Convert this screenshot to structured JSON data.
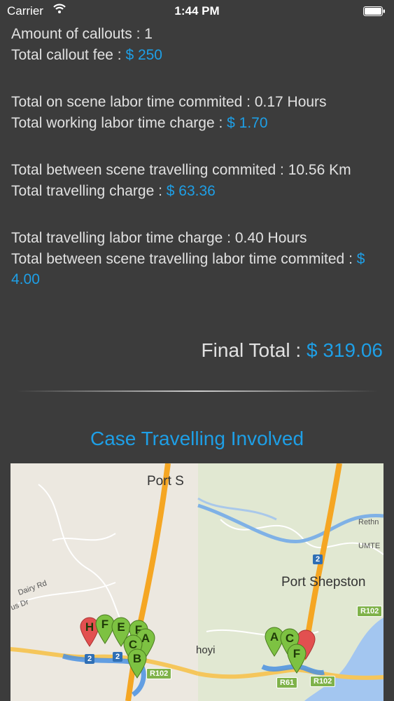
{
  "status_bar": {
    "carrier": "Carrier",
    "time": "1:44 PM"
  },
  "summary": {
    "callouts_amount": "Amount of callouts : 1",
    "callout_fee_label": "Total callout fee : ",
    "callout_fee_value": "$ 250",
    "on_scene_labor": "Total on scene labor time commited : 0.17 Hours",
    "working_labor_charge_label": "Total working labor time charge : ",
    "working_labor_charge_value": "$ 1.70",
    "between_scene_travel": "Total between scene travelling commited : 10.56 Km",
    "travelling_charge_label": "Total travelling charge : ",
    "travelling_charge_value": "$ 63.36",
    "travel_labor_time_charge": "Total travelling labor time charge : 0.40 Hours",
    "between_scene_labor_label": "Total between scene travelling labor time commited : ",
    "between_scene_labor_value": "$ 4.00",
    "final_total_label": "Final Total : ",
    "final_total_value": "$ 319.06"
  },
  "section_title": "Case Travelling Involved",
  "map": {
    "labels": {
      "port_s": "Port S",
      "port_shepstone": "Port Shepston",
      "dairy_rd": "Dairy Rd",
      "us_dr": "us Dr",
      "hoyi": "hoyi",
      "rethn": "Rethn",
      "umte": "UMTE"
    },
    "road_shields": [
      "2",
      "2",
      "2",
      "R102",
      "R102",
      "R61",
      "R102"
    ],
    "markers_left": [
      "H",
      "F",
      "E",
      "F",
      "A",
      "C",
      "B"
    ],
    "markers_right": [
      "A",
      "C",
      "F"
    ],
    "colors": {
      "marker_green": "#7dc242",
      "marker_red": "#e25050",
      "route": "#4a90e2",
      "highway": "#f0a030"
    }
  }
}
